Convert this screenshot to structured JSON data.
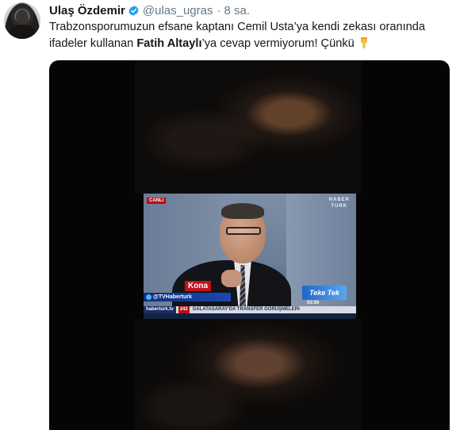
{
  "tweet": {
    "author": {
      "name": "Ulaş Özdemir",
      "handle": "@ulas_ugras",
      "verified": true,
      "separator": "·",
      "time": "8 sa."
    },
    "text": {
      "part1": "Trabzonsporumuzun efsane kaptanı Cemil Usta’ya kendi zekası oranında ifadeler kullanan ",
      "bold_name": "Fatih Altaylı",
      "part2": "’ya cevap vermiyorum! Çünkü",
      "emoji": "backhand-index-pointing-down"
    },
    "media": {
      "video": {
        "live_badge": "CANLI",
        "channel_logo_line1": "HABER",
        "channel_logo_line2": "TURK",
        "lower_third": "Kona",
        "twitter_handle": "@TVHaberturk",
        "show_name": "Teke Tek",
        "clock": "03:56",
        "ticker_url": "haberturk.tv",
        "ticker_number": "242",
        "ticker_text": "GALATASARAY'DA TRANSFER GÖRÜŞMELERİ"
      }
    }
  },
  "colors": {
    "text": "#14171a",
    "secondary": "#657786",
    "verified": "#1da1f2",
    "live": "#b80f14"
  }
}
